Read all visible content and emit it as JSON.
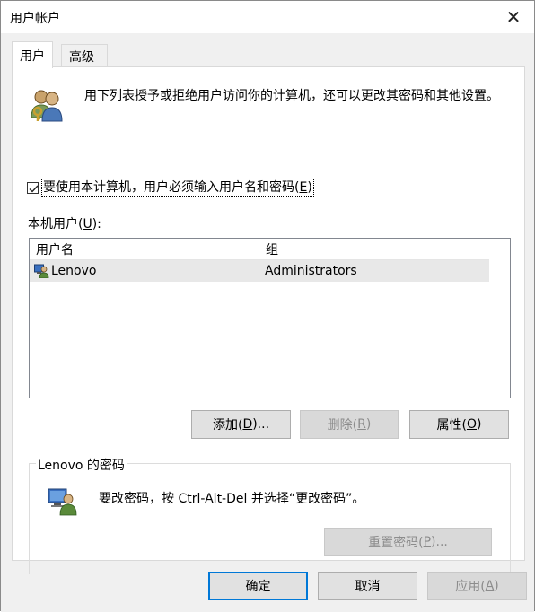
{
  "window": {
    "title": "用户帐户",
    "close_symbol": "✕"
  },
  "tabs": [
    {
      "label": "用户",
      "active": true
    },
    {
      "label": "高级",
      "active": false
    }
  ],
  "intro": {
    "icon": "users-keys-icon",
    "text": "用下列表授予或拒绝用户访问你的计算机，还可以更改其密码和其他设置。"
  },
  "require_login": {
    "checked": true,
    "label_prefix": "要使用本计算机，用户必须输入用户名和密码(",
    "accesskey": "E",
    "label_suffix": ")"
  },
  "users_section": {
    "label_prefix": "本机用户(",
    "accesskey": "U",
    "label_suffix": "):",
    "columns": [
      "用户名",
      "组"
    ],
    "rows": [
      {
        "name": "Lenovo",
        "group": "Administrators",
        "icon": "user-account-icon"
      }
    ]
  },
  "buttons": {
    "add": {
      "prefix": "添加(",
      "key": "D",
      "suffix": ")...",
      "enabled": true
    },
    "remove": {
      "prefix": "删除(",
      "key": "R",
      "suffix": ")",
      "enabled": false
    },
    "properties": {
      "prefix": "属性(",
      "key": "O",
      "suffix": ")",
      "enabled": true
    }
  },
  "password_group": {
    "title": "Lenovo 的密码",
    "text": "要改密码，按 Ctrl-Alt-Del 并选择“更改密码”。",
    "icon": "user-computer-icon",
    "reset": {
      "prefix": "重置密码(",
      "key": "P",
      "suffix": ")...",
      "enabled": false
    }
  },
  "footer": {
    "ok": "确定",
    "cancel": "取消",
    "apply": {
      "prefix": "应用(",
      "key": "A",
      "suffix": ")",
      "enabled": false
    }
  }
}
